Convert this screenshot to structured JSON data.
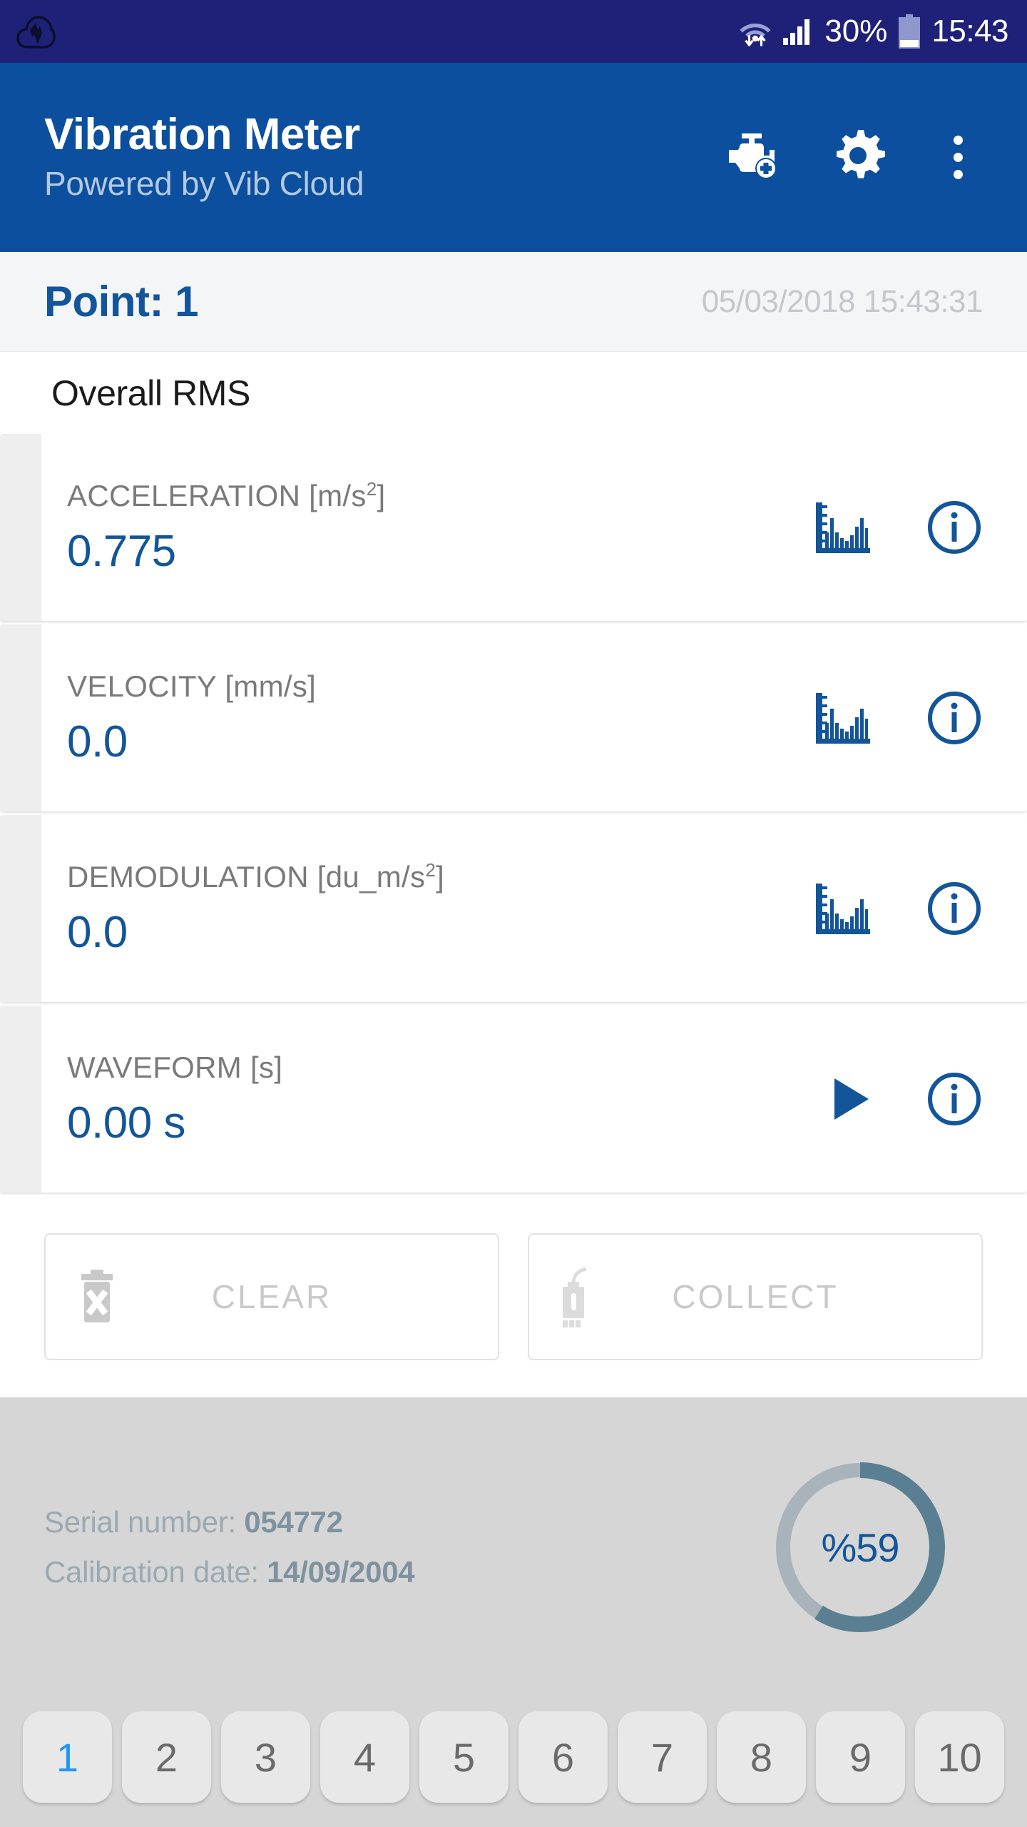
{
  "status_bar": {
    "logo_icon": "cloud-logo-icon",
    "wifi_icon": "wifi-icon",
    "signal_icon": "signal-bars-icon",
    "battery_percent": "30%",
    "battery_icon": "battery-icon",
    "time": "15:43"
  },
  "app_bar": {
    "title": "Vibration Meter",
    "subtitle": "Powered by Vib Cloud",
    "actions": [
      {
        "name": "add-machine-icon"
      },
      {
        "name": "settings-gear-icon"
      },
      {
        "name": "overflow-menu-icon"
      }
    ]
  },
  "point_header": {
    "label": "Point: 1",
    "timestamp": "05/03/2018 15:43:31"
  },
  "section": {
    "heading": "Overall RMS"
  },
  "measurements": [
    {
      "label_text": "ACCELERATION [m/s",
      "label_sup": "2",
      "label_tail": "]",
      "value": "0.775",
      "action_icon": "spectrum-chart-icon",
      "info_icon": "info-icon"
    },
    {
      "label_text": "VELOCITY [mm/s]",
      "label_sup": "",
      "label_tail": "",
      "value": "0.0",
      "action_icon": "spectrum-chart-icon",
      "info_icon": "info-icon"
    },
    {
      "label_text": "DEMODULATION [du_m/s",
      "label_sup": "2",
      "label_tail": "]",
      "value": "0.0",
      "action_icon": "spectrum-chart-icon",
      "info_icon": "info-icon"
    },
    {
      "label_text": "WAVEFORM [s]",
      "label_sup": "",
      "label_tail": "",
      "value": "0.00 s",
      "action_icon": "play-icon",
      "info_icon": "info-icon"
    }
  ],
  "buttons": {
    "clear_label": "CLEAR",
    "clear_icon": "trash-delete-icon",
    "collect_label": "COLLECT",
    "collect_icon": "sensor-probe-icon"
  },
  "footer": {
    "serial_label": "Serial number: ",
    "serial_value": "054772",
    "calibration_label": "Calibration date: ",
    "calibration_value": "14/09/2004",
    "gauge_text": "%59",
    "gauge_percent": 59
  },
  "pager": {
    "pages": [
      "1",
      "2",
      "3",
      "4",
      "5",
      "6",
      "7",
      "8",
      "9",
      "10"
    ],
    "selected_index": 0
  },
  "colors": {
    "status_bar": "#1f2178",
    "app_bar": "#0b4f9e",
    "accent_blue": "#12559b",
    "value_blue": "#12559b",
    "selected_page": "#2196f3",
    "gauge_progress": "#5b7f92",
    "gauge_track": "#a8b3bc",
    "footer_bg": "#d6d6d6"
  }
}
